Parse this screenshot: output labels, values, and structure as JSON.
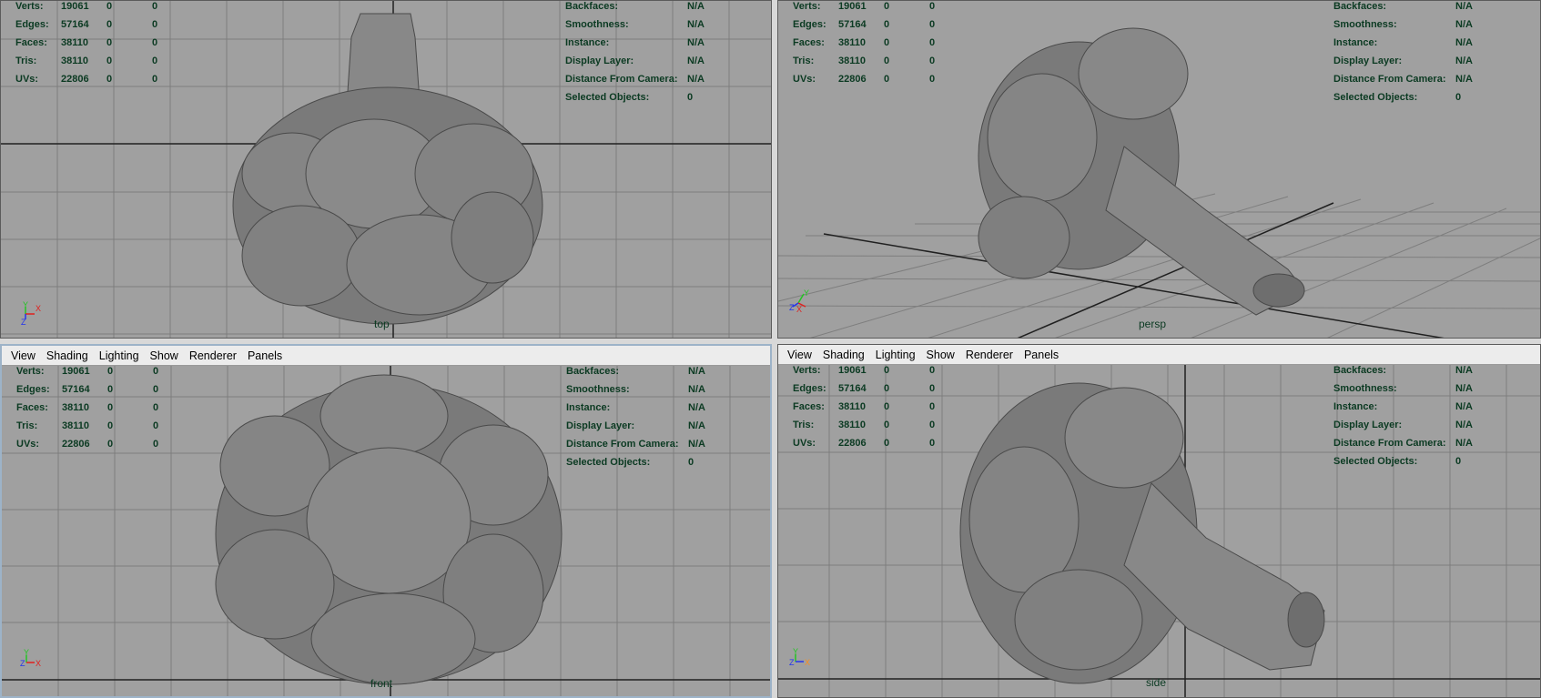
{
  "menu": [
    "View",
    "Shading",
    "Lighting",
    "Show",
    "Renderer",
    "Panels"
  ],
  "hud_left": [
    {
      "label": "Verts:",
      "v1": "19061",
      "v2": "0",
      "v3": "0"
    },
    {
      "label": "Edges:",
      "v1": "57164",
      "v2": "0",
      "v3": "0"
    },
    {
      "label": "Faces:",
      "v1": "38110",
      "v2": "0",
      "v3": "0"
    },
    {
      "label": "Tris:",
      "v1": "38110",
      "v2": "0",
      "v3": "0"
    },
    {
      "label": "UVs:",
      "v1": "22806",
      "v2": "0",
      "v3": "0"
    }
  ],
  "hud_right": [
    {
      "label": "Backfaces:",
      "value": "N/A"
    },
    {
      "label": "Smoothness:",
      "value": "N/A"
    },
    {
      "label": "Instance:",
      "value": "N/A"
    },
    {
      "label": "Display Layer:",
      "value": "N/A"
    },
    {
      "label": "Distance From Camera:",
      "value": "N/A"
    },
    {
      "label": "Selected Objects:",
      "value": "0"
    }
  ],
  "viewports": {
    "top": {
      "camera": "top"
    },
    "persp": {
      "camera": "persp"
    },
    "front": {
      "camera": "front"
    },
    "side": {
      "camera": "side"
    }
  },
  "colors": {
    "viewport_bg": "#a0a0a0",
    "hud_text": "#0b3a22",
    "axis_x": "#e0201e",
    "axis_y": "#22c522",
    "axis_z": "#2233ee",
    "active_border": "#9db3c8"
  }
}
